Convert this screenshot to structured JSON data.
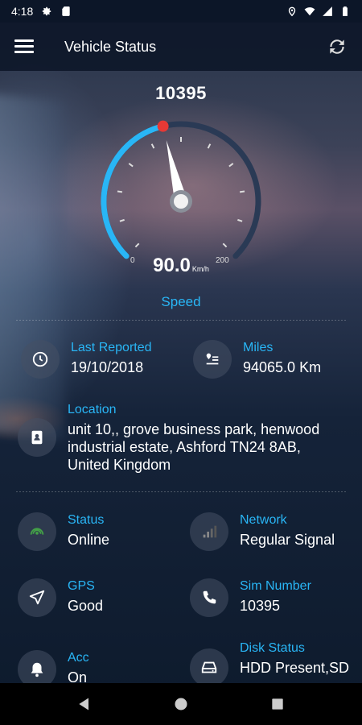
{
  "status_bar": {
    "time": "4:18",
    "icons": [
      "gear-icon",
      "sd-card-icon",
      "location-icon",
      "wifi-icon",
      "cell-signal-icon",
      "battery-icon"
    ]
  },
  "app_bar": {
    "title": "Vehicle Status",
    "left_icon": "menu-icon",
    "right_icon": "refresh-icon"
  },
  "gauge": {
    "vehicle_number": "10395",
    "speed_value": "90.0",
    "speed_unit": "Km/h",
    "min": "0",
    "max": "200",
    "speed_fraction": 0.45,
    "label": "Speed",
    "accent_color": "#29b6f6",
    "marker_color": "#e53935"
  },
  "last_reported": {
    "label": "Last Reported",
    "value": "19/10/2018",
    "icon": "clock-icon"
  },
  "miles": {
    "label": "Miles",
    "value": "94065.0 Km",
    "icon": "route-icon"
  },
  "location": {
    "label": "Location",
    "value": "unit 10,, grove business park, henwood industrial estate, Ashford TN24 8AB, United Kingdom",
    "icon": "address-book-icon"
  },
  "status": {
    "label": "Status",
    "value": "Online",
    "icon": "online-signal-icon",
    "icon_color": "#43a047"
  },
  "network": {
    "label": "Network",
    "value": "Regular Signal",
    "icon": "signal-bars-icon"
  },
  "gps": {
    "label": "GPS",
    "value": "Good",
    "icon": "navigation-arrow-icon"
  },
  "sim_number": {
    "label": "Sim Number",
    "value": "10395",
    "icon": "phone-icon"
  },
  "acc": {
    "label": "Acc",
    "value": "On",
    "icon": "bell-icon"
  },
  "disk_status": {
    "label": "Disk Status",
    "value": "HDD Present,SD",
    "icon": "hard-drive-icon"
  },
  "nav_bar": {
    "icons": [
      "back-icon",
      "home-icon",
      "recents-icon"
    ]
  }
}
